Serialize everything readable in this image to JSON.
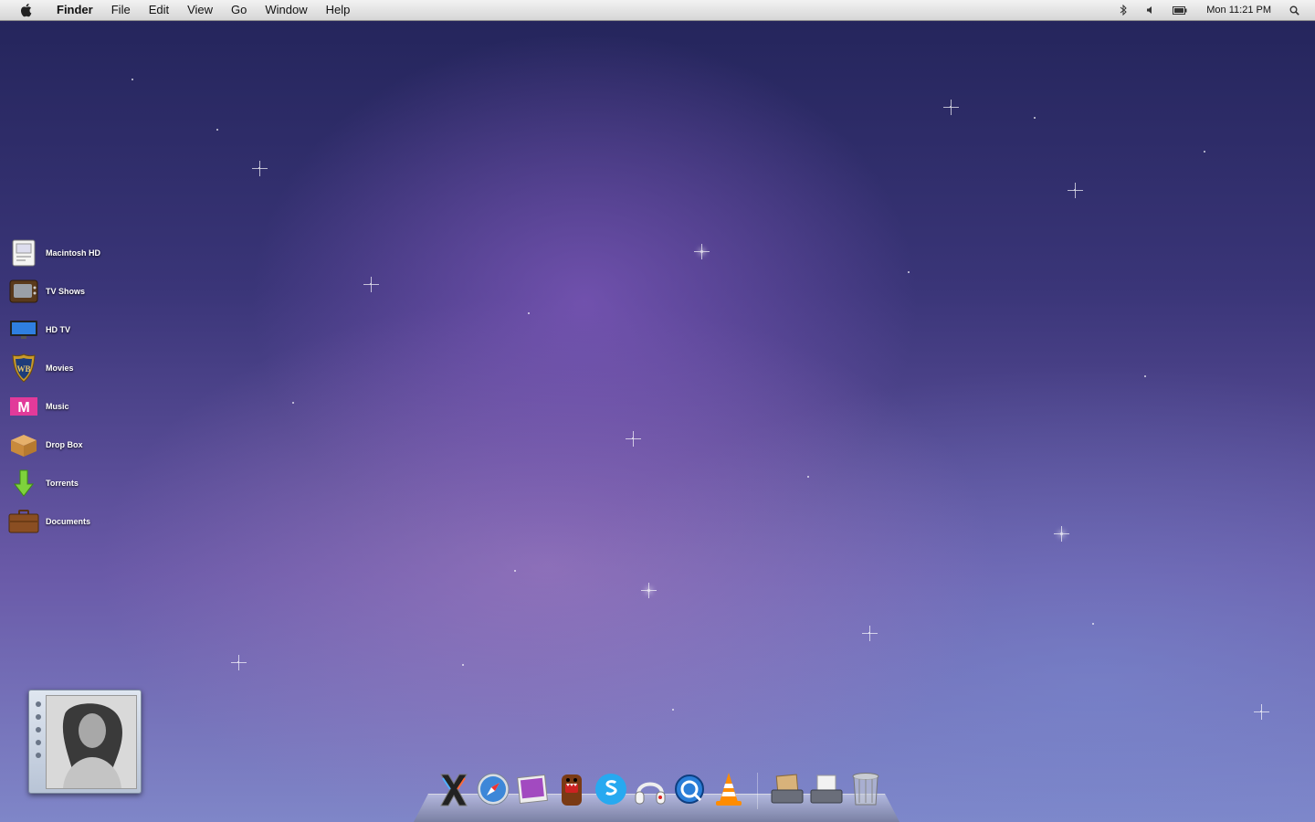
{
  "menubar": {
    "app_name": "Finder",
    "menus": [
      "File",
      "Edit",
      "View",
      "Go",
      "Window",
      "Help"
    ],
    "clock": "Mon 11:21 PM",
    "status_icons": [
      "bluetooth-icon",
      "volume-icon",
      "battery-icon",
      "spotlight-icon"
    ]
  },
  "desktop": {
    "icons": [
      {
        "label": "Macintosh HD",
        "icon": "hard-drive-icon"
      },
      {
        "label": "TV Shows",
        "icon": "tv-icon"
      },
      {
        "label": "HD TV",
        "icon": "hdtv-icon"
      },
      {
        "label": "Movies",
        "icon": "wb-shield-icon"
      },
      {
        "label": "Music",
        "icon": "mtv-icon"
      },
      {
        "label": "Drop Box",
        "icon": "box-icon"
      },
      {
        "label": "Torrents",
        "icon": "download-arrow-icon"
      },
      {
        "label": "Documents",
        "icon": "briefcase-icon"
      }
    ]
  },
  "dock": {
    "items": [
      "x-app-icon",
      "safari-icon",
      "iphoto-icon",
      "domo-icon",
      "skype-icon",
      "headphones-icon",
      "quicktime-icon",
      "vlc-icon",
      "downloads-stack-icon",
      "documents-stack-icon",
      "trash-icon"
    ]
  },
  "colors": {
    "menubar_bg": "#e4e4e4",
    "wallpaper_top": "#23245a",
    "wallpaper_mid": "#6a5aa8",
    "wallpaper_bottom": "#7f86c8"
  }
}
